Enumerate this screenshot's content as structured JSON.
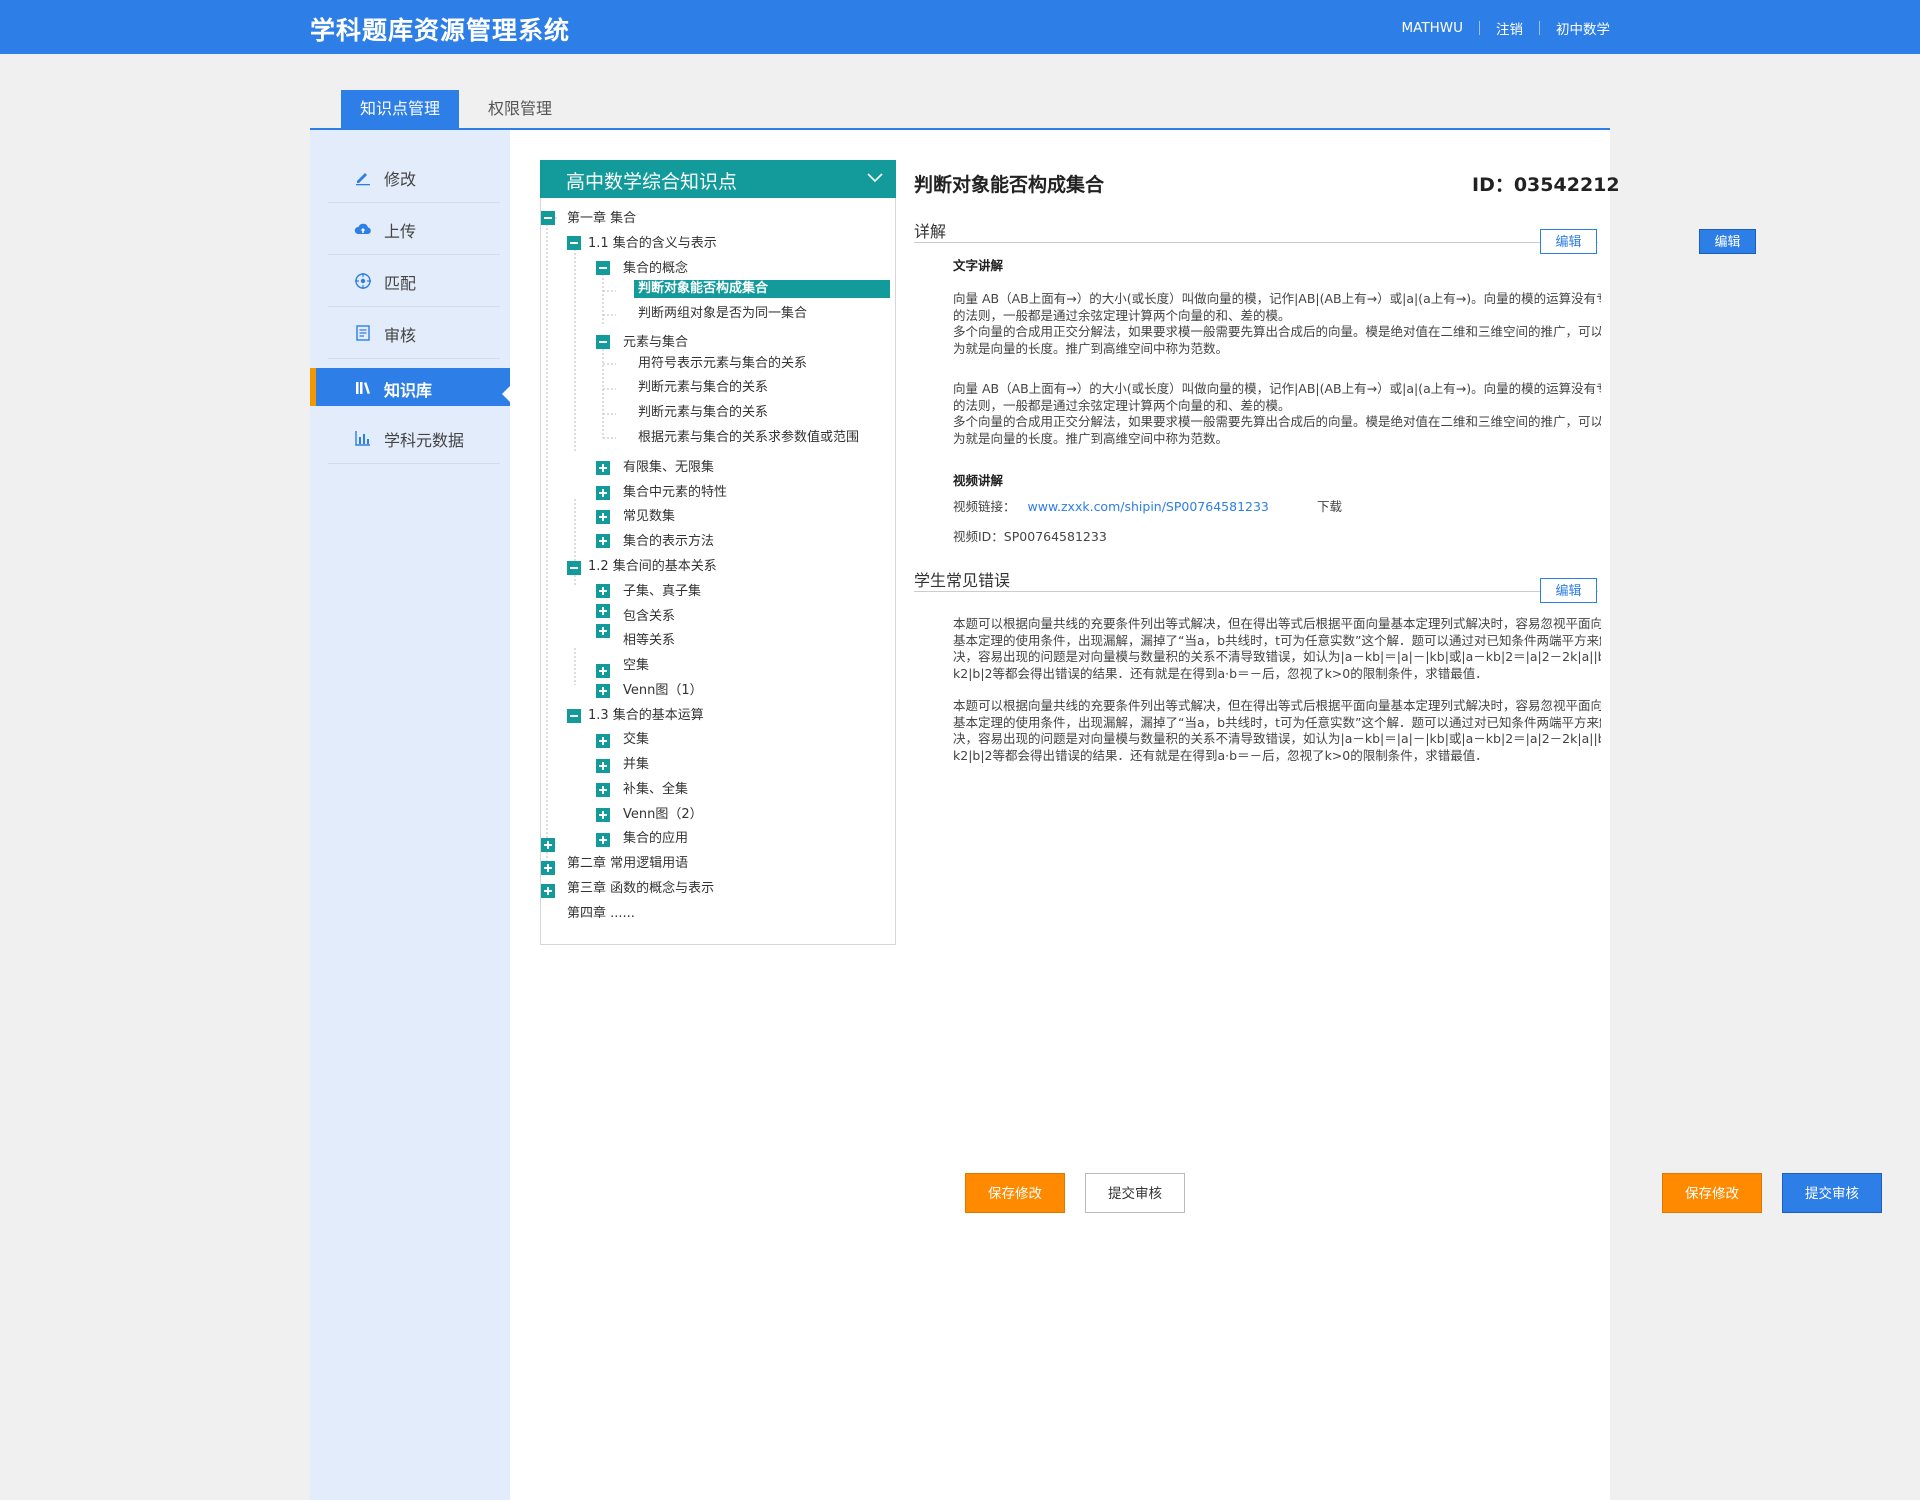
{
  "app": {
    "title": "学科题库资源管理系统"
  },
  "topnav": {
    "user": "MATHWU",
    "logout": "注销",
    "subject": "初中数学"
  },
  "tabs": [
    {
      "label": "知识点管理"
    },
    {
      "label": "权限管理"
    }
  ],
  "sidebar": {
    "items": [
      {
        "label": "修改",
        "icon": "pencil-icon"
      },
      {
        "label": "上传",
        "icon": "cloud-upload-icon"
      },
      {
        "label": "匹配",
        "icon": "crosshair-icon"
      },
      {
        "label": "审核",
        "icon": "document-icon"
      },
      {
        "label": "知识库",
        "icon": "library-icon"
      },
      {
        "label": "学科元数据",
        "icon": "bar-chart-icon"
      }
    ],
    "active": "知识库"
  },
  "tree": {
    "header": "高中数学综合知识点",
    "nodes": [
      {
        "label": "第一章 集合",
        "toggle": "minus"
      },
      {
        "label": "1.1 集合的含义与表示",
        "toggle": "minus"
      },
      {
        "label": "集合的概念",
        "toggle": "minus"
      },
      {
        "label": "判断对象能否构成集合",
        "selected": true
      },
      {
        "label": "判断两组对象是否为同一集合"
      },
      {
        "label": "元素与集合",
        "toggle": "minus"
      },
      {
        "label": "用符号表示元素与集合的关系"
      },
      {
        "label": "判断元素与集合的关系"
      },
      {
        "label": "判断元素与集合的关系"
      },
      {
        "label": "根据元素与集合的关系求参数值或范围"
      },
      {
        "label": "有限集、无限集",
        "toggle": "plus"
      },
      {
        "label": "集合中元素的特性",
        "toggle": "plus"
      },
      {
        "label": "常见数集",
        "toggle": "plus"
      },
      {
        "label": "集合的表示方法",
        "toggle": "plus"
      },
      {
        "label": "1.2 集合间的基本关系",
        "toggle": "minus"
      },
      {
        "label": "子集、真子集",
        "toggle": "plus"
      },
      {
        "label": "包含关系",
        "toggle": "plus"
      },
      {
        "label": "相等关系",
        "toggle": "plus"
      },
      {
        "label": "空集",
        "toggle": "plus"
      },
      {
        "label": "Venn图（1）",
        "toggle": "plus"
      },
      {
        "label": "1.3 集合的基本运算",
        "toggle": "minus"
      },
      {
        "label": "交集",
        "toggle": "plus"
      },
      {
        "label": "并集",
        "toggle": "plus"
      },
      {
        "label": "补集、全集",
        "toggle": "plus"
      },
      {
        "label": "Venn图（2）",
        "toggle": "plus"
      },
      {
        "label": "集合的应用",
        "toggle": "plus"
      },
      {
        "label": "第二章 常用逻辑用语",
        "toggle": "plus"
      },
      {
        "label": "第三章 函数的概念与表示",
        "toggle": "plus"
      },
      {
        "label": "第四章 ......"
      }
    ]
  },
  "detail": {
    "title": "判断对象能否构成集合",
    "id": "ID：03542212",
    "section1": {
      "title": "详解",
      "edit": "编辑",
      "text_heading": "文字讲解",
      "paragraphs": [
        [
          "向量 AB（AB上面有→）的大小(或长度）叫做向量的模，记作|AB|(AB上有→）或|a|(a上有→)。向量的模的运算没有专门",
          "的法则，一般都是通过余弦定理计算两个向量的和、差的模。",
          "多个向量的合成用正交分解法，如果要求模一般需要先算出合成后的向量。模是绝对值在二维和三维空间的推广，可以认",
          "为就是向量的长度。推广到高维空间中称为范数。"
        ],
        [
          "向量 AB（AB上面有→）的大小(或长度）叫做向量的模，记作|AB|(AB上有→）或|a|(a上有→)。向量的模的运算没有专门",
          "的法则，一般都是通过余弦定理计算两个向量的和、差的模。",
          "多个向量的合成用正交分解法，如果要求模一般需要先算出合成后的向量。模是绝对值在二维和三维空间的推广，可以认",
          "为就是向量的长度。推广到高维空间中称为范数。"
        ]
      ],
      "video_heading": "视频讲解",
      "video_link_label": "视频链接：",
      "video_link": "www.zxxk.com/shipin/SP00764581233",
      "download": "下载",
      "video_id": "视频ID：SP00764581233"
    },
    "section2": {
      "title": "学生常见错误",
      "edit": "编辑",
      "paragraphs": [
        [
          "本题可以根据向量共线的充要条件列出等式解决，但在得出等式后根据平面向量基本定理列式解决时，容易忽视平面向量",
          "基本定理的使用条件，出现漏解，漏掉了“当a，b共线时，t可为任意实数”这个解．题可以通过对已知条件两端平方来解",
          "决，容易出现的问题是对向量模与数量积的关系不清导致错误，如认为|a－kb|＝|a|－|kb|或|a－kb|2＝|a|2－2k|a||b|＋",
          "k2|b|2等都会得出错误的结果．还有就是在得到a·b＝－后，忽视了k>0的限制条件，求错最值．"
        ],
        [
          "本题可以根据向量共线的充要条件列出等式解决，但在得出等式后根据平面向量基本定理列式解决时，容易忽视平面向量",
          "基本定理的使用条件，出现漏解，漏掉了“当a，b共线时，t可为任意实数”这个解．题可以通过对已知条件两端平方来解",
          "决，容易出现的问题是对向量模与数量积的关系不清导致错误，如认为|a－kb|＝|a|－|kb|或|a－kb|2＝|a|2－2k|a||b|＋",
          "k2|b|2等都会得出错误的结果．还有就是在得到a·b＝－后，忽视了k>0的限制条件，求错最值．"
        ]
      ]
    },
    "actions": {
      "save": "保存修改",
      "submit": "提交审核"
    }
  },
  "outside": {
    "edit": "编辑",
    "save": "保存修改",
    "submit": "提交审核"
  },
  "colors": {
    "primary": "#2d7ee6",
    "teal": "#139b9b",
    "orange": "#ff8a00",
    "sidebar_bg": "#e3ecfa"
  }
}
